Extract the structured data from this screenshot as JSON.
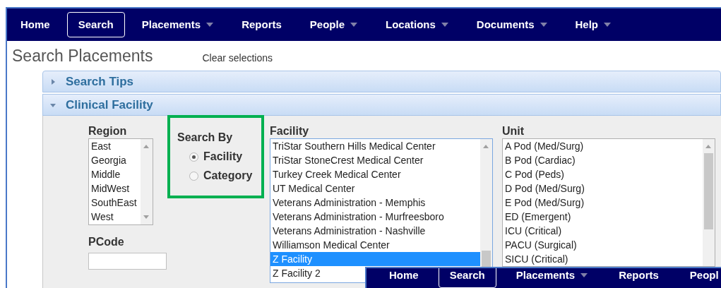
{
  "nav": [
    {
      "label": "Home",
      "selected": false,
      "dropdown": false
    },
    {
      "label": "Search",
      "selected": true,
      "dropdown": false
    },
    {
      "label": "Placements",
      "selected": false,
      "dropdown": true
    },
    {
      "label": "Reports",
      "selected": false,
      "dropdown": false
    },
    {
      "label": "People",
      "selected": false,
      "dropdown": true
    },
    {
      "label": "Locations",
      "selected": false,
      "dropdown": true
    },
    {
      "label": "Documents",
      "selected": false,
      "dropdown": true
    },
    {
      "label": "Help",
      "selected": false,
      "dropdown": true
    }
  ],
  "page_title": "Search Placements",
  "clear_link": "Clear selections",
  "sections": [
    {
      "title": "Search Tips",
      "expanded": false
    },
    {
      "title": "Clinical Facility",
      "expanded": true
    }
  ],
  "region": {
    "label": "Region",
    "items": [
      {
        "label": "East",
        "selected": false
      },
      {
        "label": "Georgia",
        "selected": false
      },
      {
        "label": "Middle",
        "selected": false
      },
      {
        "label": "MidWest",
        "selected": false
      },
      {
        "label": "SouthEast",
        "selected": false
      },
      {
        "label": "West",
        "selected": false
      }
    ]
  },
  "pcode": {
    "label": "PCode"
  },
  "search_by": {
    "label": "Search By",
    "options": [
      {
        "label": "Facility",
        "selected": true
      },
      {
        "label": "Category",
        "selected": false
      }
    ]
  },
  "facility": {
    "label": "Facility",
    "items": [
      {
        "label": "TriStar Southern Hills Medical Center",
        "selected": false
      },
      {
        "label": "TriStar StoneCrest Medical Center",
        "selected": false
      },
      {
        "label": "Turkey Creek Medical Center",
        "selected": false
      },
      {
        "label": "UT Medical Center",
        "selected": false
      },
      {
        "label": "Veterans Administration - Memphis",
        "selected": false
      },
      {
        "label": "Veterans Administration - Murfreesboro",
        "selected": false
      },
      {
        "label": "Veterans Administration - Nashville",
        "selected": false
      },
      {
        "label": "Williamson Medical Center",
        "selected": false
      },
      {
        "label": "Z Facility",
        "selected": true
      },
      {
        "label": "Z Facility 2",
        "selected": false
      }
    ]
  },
  "unit": {
    "label": "Unit",
    "items": [
      {
        "label": "A Pod (Med/Surg)",
        "selected": false
      },
      {
        "label": "B Pod (Cardiac)",
        "selected": false
      },
      {
        "label": "C Pod (Peds)",
        "selected": false
      },
      {
        "label": "D Pod (Med/Surg)",
        "selected": false
      },
      {
        "label": "E Pod (Med/Surg)",
        "selected": false
      },
      {
        "label": "ED (Emergent)",
        "selected": false
      },
      {
        "label": "ICU (Critical)",
        "selected": false
      },
      {
        "label": "PACU (Surgical)",
        "selected": false
      },
      {
        "label": "SICU (Critical)",
        "selected": false
      }
    ]
  },
  "overlay_nav": [
    {
      "label": "Home",
      "selected": false,
      "dropdown": false
    },
    {
      "label": "Search",
      "selected": true,
      "dropdown": false
    },
    {
      "label": "Placements",
      "selected": false,
      "dropdown": true
    },
    {
      "label": "Reports",
      "selected": false,
      "dropdown": false
    },
    {
      "label": "Peopl",
      "selected": false,
      "dropdown": false
    }
  ]
}
